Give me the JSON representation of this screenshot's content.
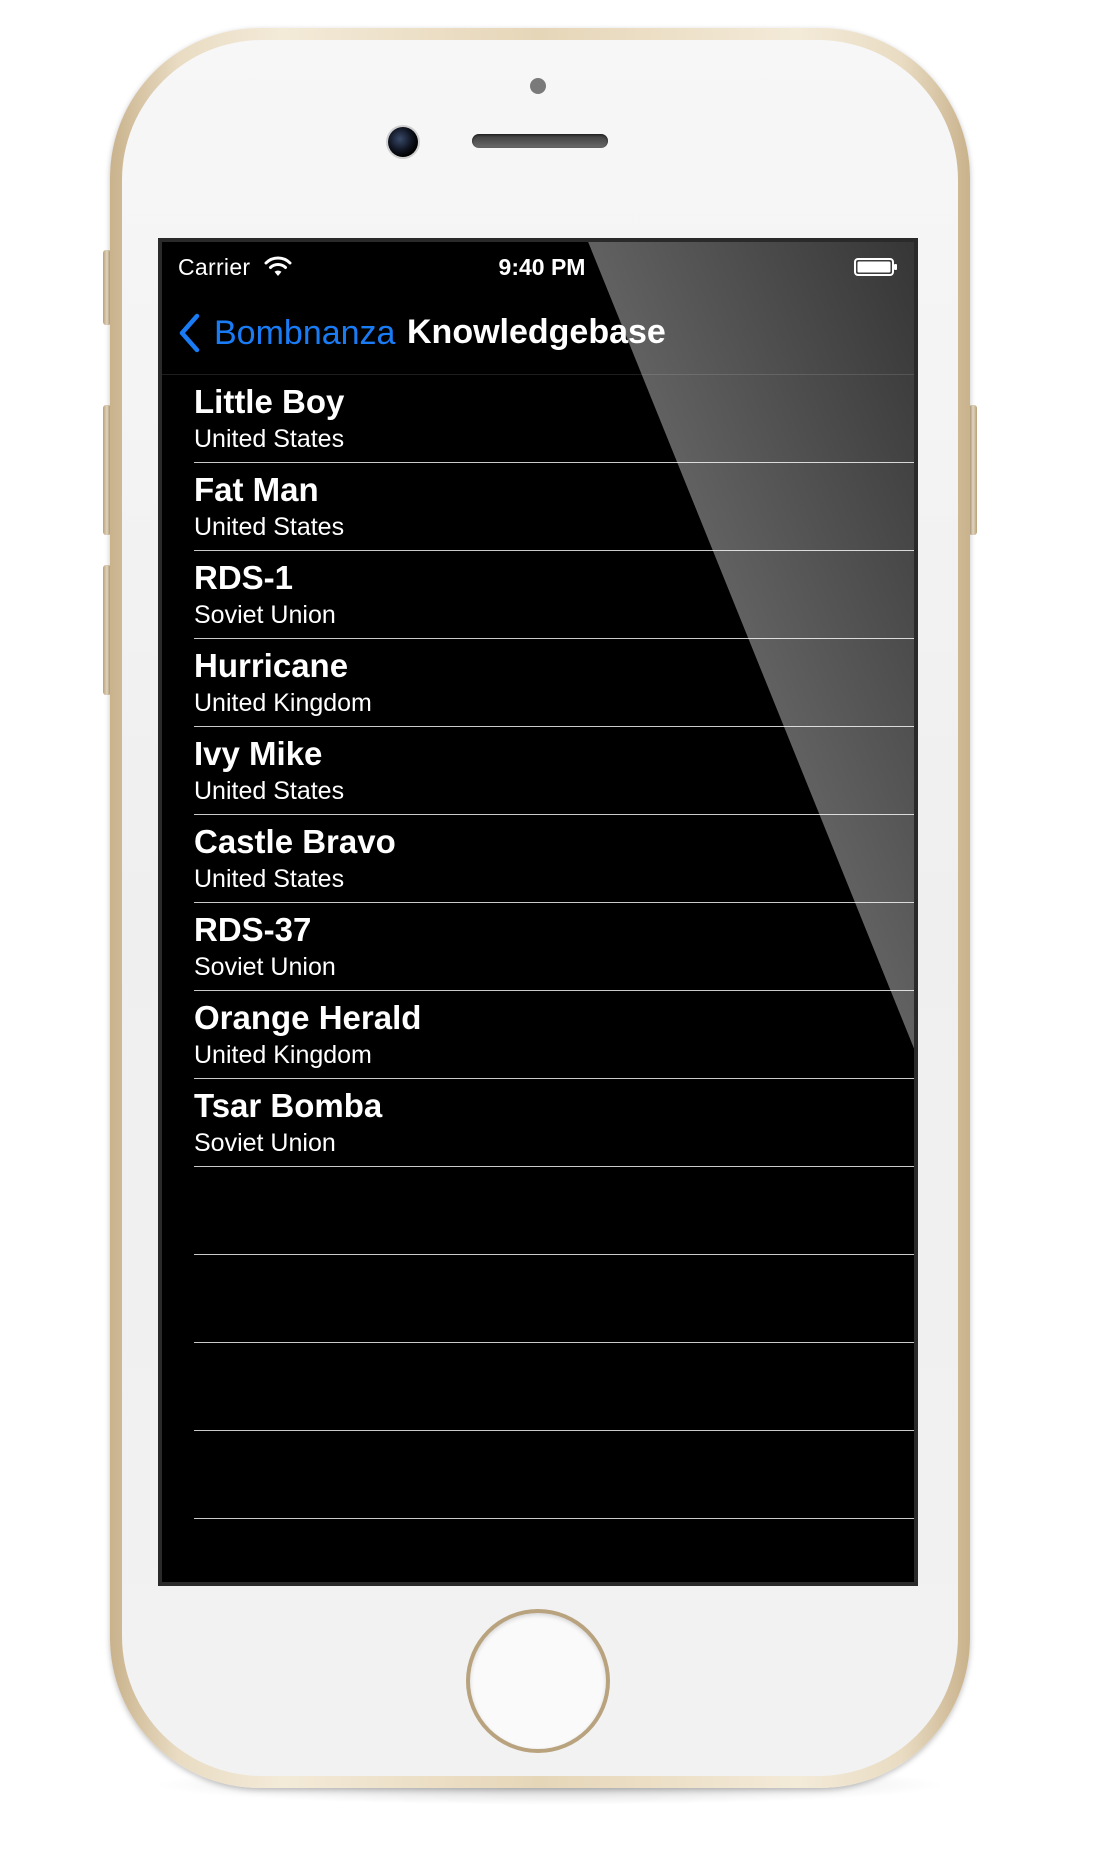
{
  "status_bar": {
    "carrier": "Carrier",
    "time": "9:40 PM"
  },
  "nav": {
    "back_label": "Bombnanza",
    "title": "Knowledgebase"
  },
  "list": {
    "items": [
      {
        "name": "Little Boy",
        "country": "United States"
      },
      {
        "name": "Fat Man",
        "country": "United States"
      },
      {
        "name": "RDS-1",
        "country": "Soviet Union"
      },
      {
        "name": "Hurricane",
        "country": "United Kingdom"
      },
      {
        "name": "Ivy Mike",
        "country": "United States"
      },
      {
        "name": "Castle Bravo",
        "country": "United States"
      },
      {
        "name": "RDS-37",
        "country": "Soviet Union"
      },
      {
        "name": "Orange Herald",
        "country": "United Kingdom"
      },
      {
        "name": "Tsar Bomba",
        "country": "Soviet Union"
      }
    ]
  },
  "icons": {
    "wifi": "wifi-icon",
    "battery": "battery-icon",
    "back": "chevron-left-icon"
  },
  "colors": {
    "accent": "#1a7cf5",
    "screen_background": "#000000",
    "text": "#ffffff",
    "separator": "#c9c9c9",
    "phone_trim": "#e6d6b8"
  }
}
